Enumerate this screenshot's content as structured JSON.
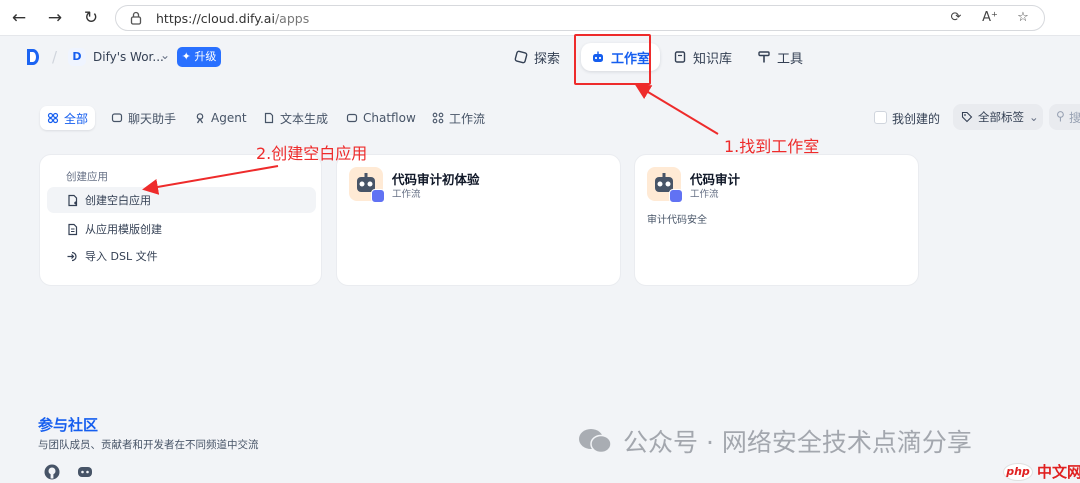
{
  "browser": {
    "url_host": "https://cloud.dify.ai",
    "url_path": "/apps"
  },
  "header": {
    "workspace_initial": "D",
    "workspace_name": "Dify's Wor...",
    "upgrade_label": "升级",
    "nav": [
      {
        "label": "探索",
        "icon": "compass-icon"
      },
      {
        "label": "工作室",
        "icon": "robot-icon"
      },
      {
        "label": "知识库",
        "icon": "book-icon"
      },
      {
        "label": "工具",
        "icon": "hammer-icon"
      }
    ]
  },
  "filters": {
    "tabs": [
      {
        "label": "全部"
      },
      {
        "label": "聊天助手"
      },
      {
        "label": "Agent"
      },
      {
        "label": "文本生成"
      },
      {
        "label": "Chatflow"
      },
      {
        "label": "工作流"
      }
    ],
    "mine_label": "我创建的",
    "tags_label": "全部标签",
    "search_placeholder": "搜"
  },
  "create_card": {
    "title": "创建应用",
    "items": [
      {
        "label": "创建空白应用"
      },
      {
        "label": "从应用模版创建"
      },
      {
        "label": "导入 DSL 文件"
      }
    ]
  },
  "apps": [
    {
      "name": "代码审计初体验",
      "type": "工作流",
      "description": ""
    },
    {
      "name": "代码审计",
      "type": "工作流",
      "description": "审计代码安全"
    }
  ],
  "annotations": {
    "step1": "1.找到工作室",
    "step2": "2.创建空白应用"
  },
  "footer": {
    "community_title": "参与社区",
    "community_subtitle": "与团队成员、贡献者和开发者在不同频道中交流"
  },
  "watermark": {
    "text": "公众号 · 网络安全技术点滴分享",
    "php_badge": "php",
    "site_label": "中文网"
  },
  "colors": {
    "accent": "#155eef",
    "annotation_red": "#ee2b2b"
  }
}
